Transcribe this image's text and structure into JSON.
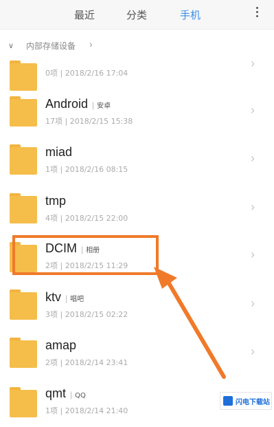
{
  "tabs": [
    {
      "label": "最近"
    },
    {
      "label": "分类"
    },
    {
      "label": "手机"
    }
  ],
  "breadcrumb": {
    "label": "内部存储设备"
  },
  "folders": [
    {
      "name": "",
      "tag": "",
      "meta": "0项 | 2018/2/16 17:04"
    },
    {
      "name": "Android",
      "tag": "安卓",
      "meta": "17项 | 2018/2/15 15:38"
    },
    {
      "name": "miad",
      "tag": "",
      "meta": "1项 | 2018/2/16 08:15"
    },
    {
      "name": "tmp",
      "tag": "",
      "meta": "4项 | 2018/2/15 22:00"
    },
    {
      "name": "DCIM",
      "tag": "相册",
      "meta": "2项 | 2018/2/15 11:29"
    },
    {
      "name": "ktv",
      "tag": "唱吧",
      "meta": "3项 | 2018/2/15 02:22"
    },
    {
      "name": "amap",
      "tag": "",
      "meta": "2项 | 2018/2/14 23:41"
    },
    {
      "name": "qmt",
      "tag": "QQ",
      "meta": "1项 | 2018/2/14 21:40"
    }
  ],
  "watermark": {
    "text": "闪电下载站"
  },
  "colors": {
    "accent": "#3a8fe8",
    "folder": "#f5bd4a",
    "highlight": "#f07a2a"
  }
}
